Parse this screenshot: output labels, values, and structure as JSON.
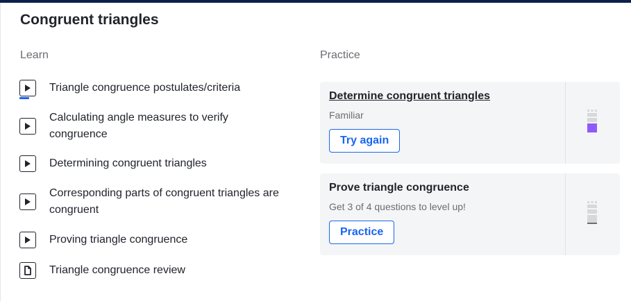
{
  "title": "Congruent triangles",
  "learn": {
    "label": "Learn",
    "items": [
      {
        "text": "Triangle congruence postulates/criteria",
        "icon": "video-icon",
        "started": true
      },
      {
        "text": "Calculating angle measures to verify congruence",
        "icon": "video-icon"
      },
      {
        "text": "Determining congruent triangles",
        "icon": "video-icon"
      },
      {
        "text": "Corresponding parts of congruent triangles are congruent",
        "icon": "video-icon"
      },
      {
        "text": "Proving triangle congruence",
        "icon": "video-icon"
      },
      {
        "text": "Triangle congruence review",
        "icon": "article-icon"
      }
    ]
  },
  "practice": {
    "label": "Practice",
    "cards": [
      {
        "title": "Determine congruent triangles",
        "subtitle": "Familiar",
        "button": "Try again",
        "mastery_color": "#9059ff"
      },
      {
        "title": "Prove triangle congruence",
        "subtitle": "Get 3 of 4 questions to level up!",
        "button": "Practice",
        "mastery_color": "#b8b9bc"
      }
    ]
  },
  "colors": {
    "accent": "#1865f2",
    "header_bar": "#0b2149",
    "card_bg": "#f4f5f6",
    "familiar": "#9059ff"
  }
}
